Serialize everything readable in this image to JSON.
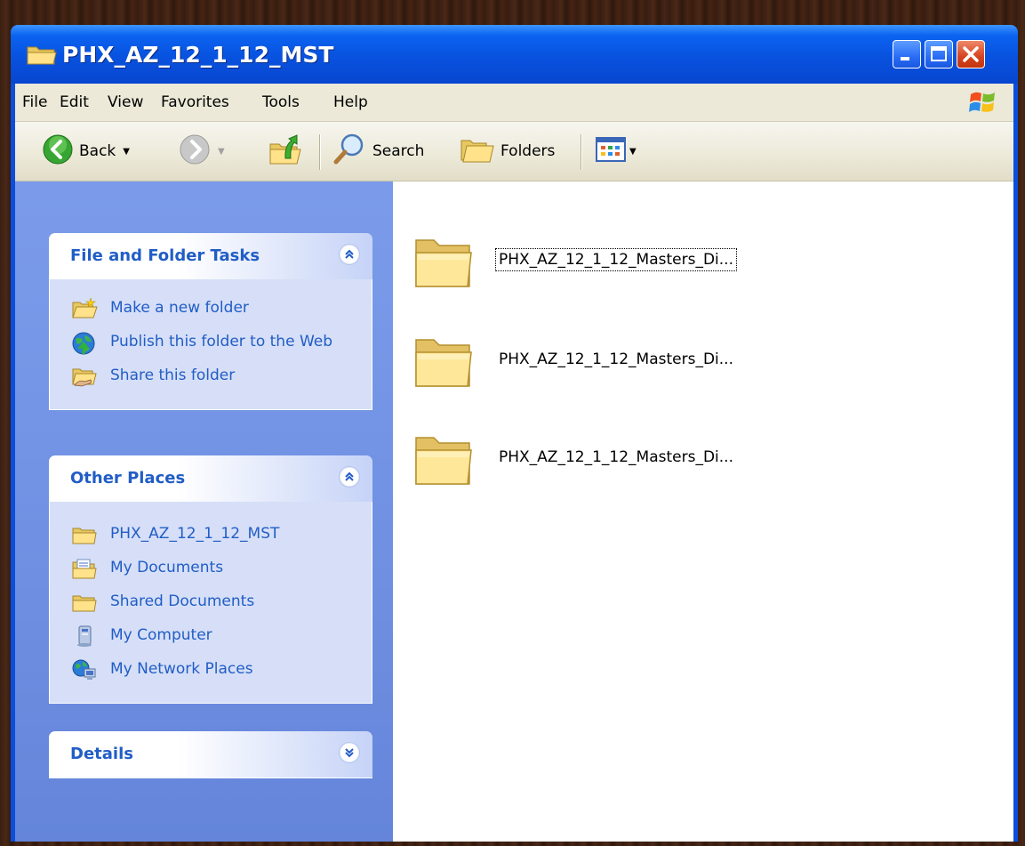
{
  "window": {
    "title": "PHX_AZ_12_1_12_MST"
  },
  "menu": [
    "File",
    "Edit",
    "View",
    "Favorites",
    "Tools",
    "Help"
  ],
  "toolbar": {
    "back_label": "Back",
    "search_label": "Search",
    "folders_label": "Folders"
  },
  "task_pane": {
    "file_tasks": {
      "title": "File and Folder Tasks",
      "items": [
        {
          "label": "Make a new folder",
          "icon": "new-folder-icon"
        },
        {
          "label": "Publish this folder to the Web",
          "icon": "publish-web-icon"
        },
        {
          "label": "Share this folder",
          "icon": "share-folder-icon"
        }
      ]
    },
    "other_places": {
      "title": "Other Places",
      "items": [
        {
          "label": "PHX_AZ_12_1_12_MST",
          "icon": "folder-icon"
        },
        {
          "label": "My Documents",
          "icon": "my-documents-icon"
        },
        {
          "label": "Shared Documents",
          "icon": "folder-icon"
        },
        {
          "label": "My Computer",
          "icon": "my-computer-icon"
        },
        {
          "label": "My Network Places",
          "icon": "network-places-icon"
        }
      ]
    },
    "details": {
      "title": "Details"
    }
  },
  "files": [
    {
      "name": "PHX_AZ_12_1_12_Masters_Di...",
      "focused": true
    },
    {
      "name": "PHX_AZ_12_1_12_Masters_Di...",
      "focused": false
    },
    {
      "name": "PHX_AZ_12_1_12_Masters_Di...",
      "focused": false
    }
  ],
  "colors": {
    "titlebar": "#0852df",
    "task_pane": "#6f8fe2",
    "task_link": "#215dc6",
    "close_button": "#d6431f"
  }
}
